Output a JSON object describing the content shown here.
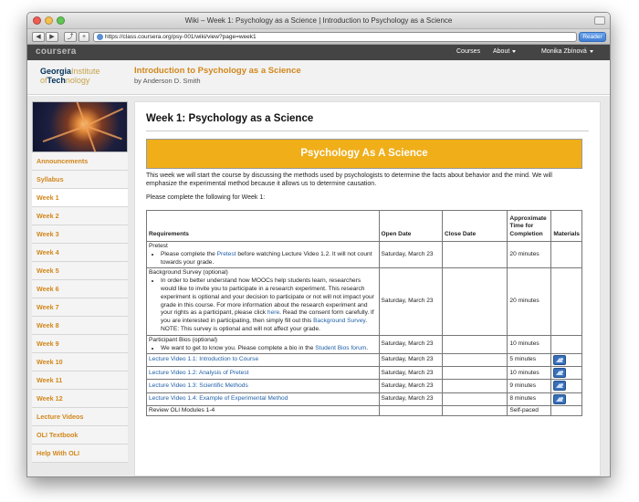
{
  "browser": {
    "window_title": "Wiki – Week 1: Psychology as a Science | Introduction to Psychology as a Science",
    "url": "https://class.coursera.org/psy-001/wiki/view?page=week1",
    "reader_label": "Reader",
    "back_glyph": "◀",
    "forward_glyph": "▶",
    "share_glyph": "⤴"
  },
  "topnav": {
    "logo": "coursera",
    "items": [
      "Courses",
      "About",
      "Monika Zbínová"
    ]
  },
  "course": {
    "logo_line1_a": "Georgia",
    "logo_line1_b": "Institute",
    "logo_line2_a": "of",
    "logo_line2_b": "Tech",
    "logo_line2_c": "nology",
    "title": "Introduction to Psychology as a Science",
    "by": "by Anderson D. Smith"
  },
  "sidebar": {
    "items": [
      "Announcements",
      "Syllabus",
      "Week 1",
      "Week 2",
      "Week 3",
      "Week 4",
      "Week 5",
      "Week 6",
      "Week 7",
      "Week 8",
      "Week 9",
      "Week 10",
      "Week 11",
      "Week 12",
      "Lecture Videos",
      "OLI Textbook",
      "Help With OLI"
    ],
    "active": "Week 1"
  },
  "main": {
    "title": "Week 1: Psychology as a Science",
    "banner": "Psychology As A Science",
    "intro": "This week we will start the course by discussing the methods used by psychologists to determine the facts about behavior and the mind. We will emphasize the experimental method because it allows us to determine causation.",
    "complete": "Please complete the following for Week 1:"
  },
  "table": {
    "headers": {
      "requirements": "Requirements",
      "open": "Open Date",
      "close": "Close Date",
      "time": "Approximate Time for Completion",
      "materials": "Materials"
    },
    "pretest": {
      "heading": "Pretest",
      "t1": "Please complete the ",
      "link": "Pretest",
      "t2": " before watching Lecture Video 1.2. It will not count towards your grade.",
      "open": "Saturday, March 23",
      "time": "20 minutes"
    },
    "survey": {
      "heading": "Background Survey (optional)",
      "t1": "In order to better understand how MOOCs help students learn, researchers would like to invite you to participate in a research experiment. This research experiment is optional and your decision to participate or not will not impact your grade in this course. For more information about the research experiment and your rights as a participant, please click ",
      "link1": "here",
      "t2": ". Read the consent form carefully. If you are interested in participating, then simply fill out this ",
      "link2": "Background Survey",
      "t3": ". NOTE: This survey is optional and will not affect your grade.",
      "open": "Saturday, March 23",
      "time": "20 minutes"
    },
    "bios": {
      "heading": "Participant Bios (optional)",
      "t1": "We want to get to know you. Please complete a bio in the ",
      "link": "Student Bios forum",
      "t2": ".",
      "open": "Saturday, March 23",
      "time": "10 minutes"
    },
    "lectures": [
      {
        "title": "Lecture Video 1.1: Introduction to Course",
        "open": "Saturday, March 23",
        "time": "5 minutes"
      },
      {
        "title": "Lecture Video 1.2: Analysis of Pretest",
        "open": "Saturday, March 23",
        "time": "10 minutes"
      },
      {
        "title": "Lecture Video 1.3: Scientific Methods",
        "open": "Saturday, March 23",
        "time": "9 minutes"
      },
      {
        "title": "Lecture Video 1.4: Example of Experimental Method",
        "open": "Saturday, March 23",
        "time": "8 minutes"
      }
    ],
    "oli": {
      "title": "Review OLI Modules 1-4",
      "time": "Self-paced"
    },
    "material_icon": "image-icon"
  },
  "colors": {
    "accent": "#d2871b",
    "banner": "#f0ae19",
    "link": "#1f5fa8",
    "topnav": "#444444"
  }
}
